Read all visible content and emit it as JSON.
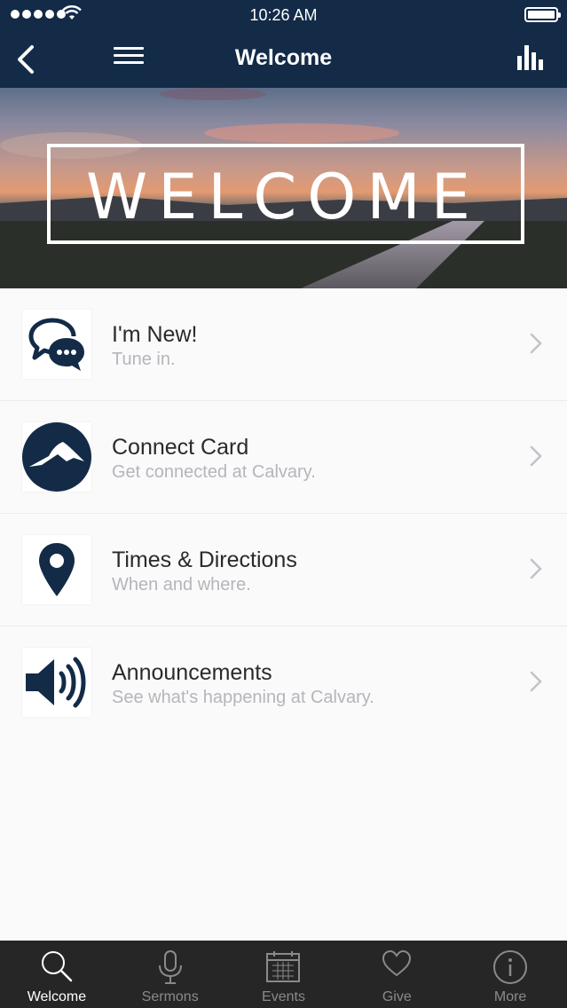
{
  "status_bar": {
    "time": "10:26 AM"
  },
  "nav": {
    "title": "Welcome"
  },
  "hero": {
    "text": "WELCOME"
  },
  "items": [
    {
      "title": "I'm New!",
      "subtitle": "Tune in.",
      "icon": "chat-bubbles-icon"
    },
    {
      "title": "Connect Card",
      "subtitle": "Get connected at Calvary.",
      "icon": "mountain-logo-icon"
    },
    {
      "title": "Times & Directions",
      "subtitle": "When and where.",
      "icon": "map-pin-icon"
    },
    {
      "title": "Announcements",
      "subtitle": "See what's happening at Calvary.",
      "icon": "speaker-icon"
    }
  ],
  "tabs": [
    {
      "label": "Welcome",
      "icon": "search-icon",
      "active": true
    },
    {
      "label": "Sermons",
      "icon": "microphone-icon",
      "active": false
    },
    {
      "label": "Events",
      "icon": "calendar-icon",
      "active": false
    },
    {
      "label": "Give",
      "icon": "heart-icon",
      "active": false
    },
    {
      "label": "More",
      "icon": "info-icon",
      "active": false
    }
  ],
  "colors": {
    "nav_bg": "#132b47",
    "icon_navy": "#132b47",
    "tab_bg": "#262626"
  }
}
